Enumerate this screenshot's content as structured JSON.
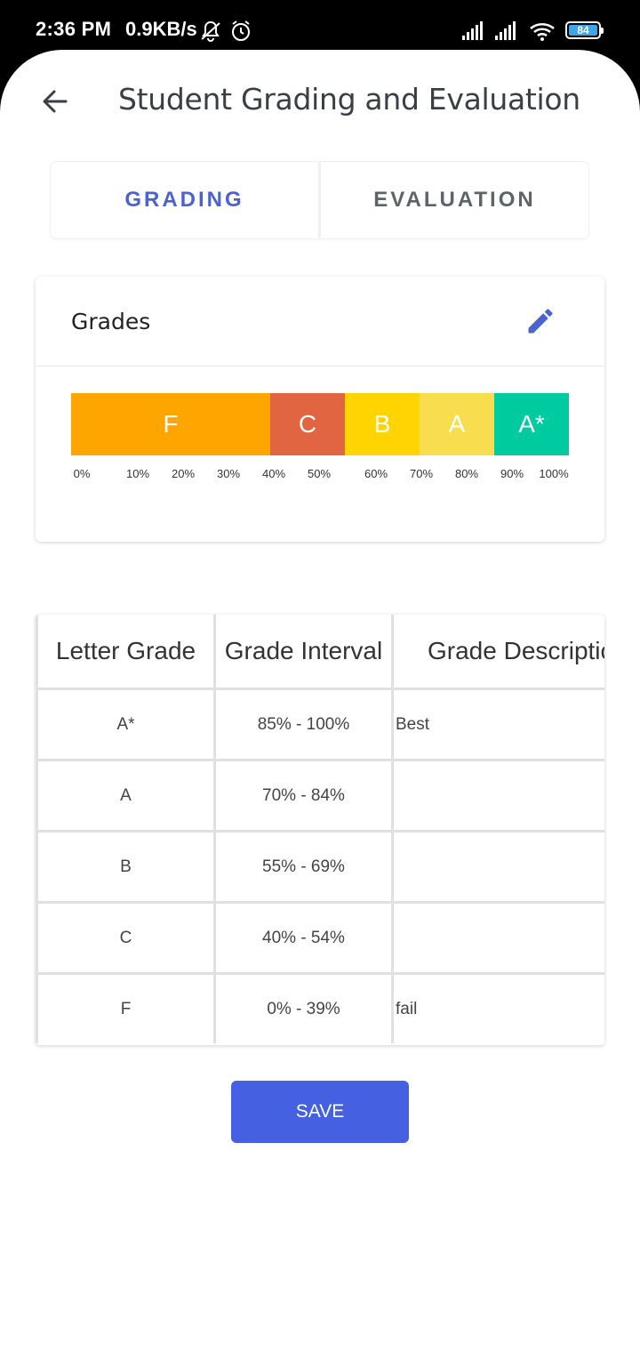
{
  "status_bar": {
    "time": "2:36 PM",
    "speed": "0.9KB/s",
    "battery": "84",
    "icons": [
      "mute-icon",
      "alarm-icon",
      "signal-icon",
      "signal-icon",
      "wifi-icon",
      "battery-icon"
    ]
  },
  "app_bar": {
    "back_icon": "arrow-left-icon",
    "title": "Student Grading and Evaluation"
  },
  "tabs": [
    {
      "label": "GRADING",
      "active": true
    },
    {
      "label": "EVALUATION",
      "active": false
    }
  ],
  "grades_card": {
    "title": "Grades",
    "edit_icon": "pencil-icon",
    "segments": [
      {
        "label": "F",
        "start": 0,
        "end": 40,
        "color": "#FFA500"
      },
      {
        "label": "C",
        "start": 40,
        "end": 55,
        "color": "#E06540"
      },
      {
        "label": "B",
        "start": 55,
        "end": 70,
        "color": "#FFD400"
      },
      {
        "label": "A",
        "start": 70,
        "end": 85,
        "color": "#F8DE4E"
      },
      {
        "label": "A*",
        "start": 85,
        "end": 100,
        "color": "#00CBA0"
      }
    ],
    "ticks": [
      "0%",
      "10%",
      "20%",
      "30%",
      "40%",
      "50%",
      "60%",
      "70%",
      "80%",
      "90%",
      "100%"
    ]
  },
  "table": {
    "headers": [
      "Letter Grade",
      "Grade Interval",
      "Grade Descriptio"
    ],
    "rows": [
      {
        "grade": "A*",
        "interval": "85% - 100%",
        "description": "Best"
      },
      {
        "grade": "A",
        "interval": "70% - 84%",
        "description": ""
      },
      {
        "grade": "B",
        "interval": "55% - 69%",
        "description": ""
      },
      {
        "grade": "C",
        "interval": "40% - 54%",
        "description": ""
      },
      {
        "grade": "F",
        "interval": "0% - 39%",
        "description": "fail"
      }
    ]
  },
  "save_button": {
    "label": "SAVE"
  },
  "colors": {
    "accent": "#4560E0",
    "tab_active": "#4A63D3"
  }
}
